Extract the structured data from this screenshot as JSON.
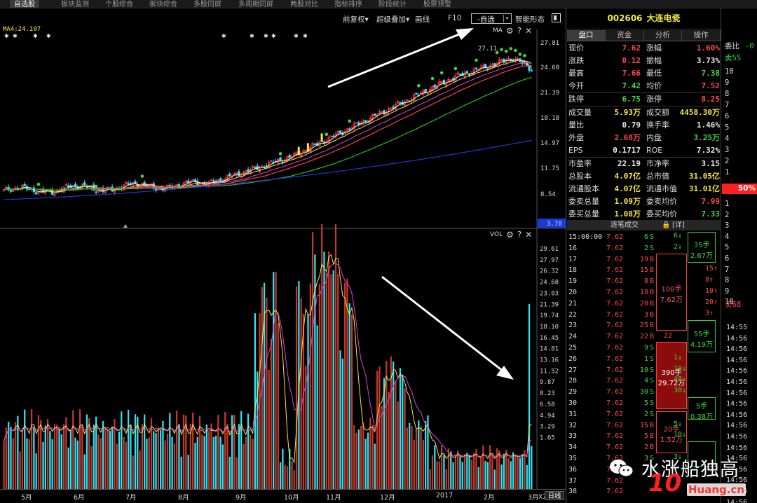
{
  "top_tabs": [
    "自选股",
    "板块监测",
    "个股综合",
    "板块综合",
    "多股同屏",
    "多周期同屏",
    "两股对比",
    "指标排序",
    "阶段统计",
    "股票预警"
  ],
  "toolbar": {
    "restore": "前复权▾",
    "overlay": "超级叠加▾",
    "draw": "画线",
    "f10": "F10",
    "watchlist": "-自选",
    "watch_dropdown": "▾",
    "smart": "智能形态"
  },
  "ma_panel": {
    "label": "MA",
    "ma_value": "MA4:24.107"
  },
  "vol_panel": {
    "label": "VOL"
  },
  "price_axis": [
    "27.81",
    "24.60",
    "21.39",
    "18.18",
    "14.97",
    "11.75",
    "8.54",
    "3.78"
  ],
  "vol_axis": [
    "29.61",
    "27.97",
    "26.32",
    "24.68",
    "23.03",
    "21.39",
    "19.74",
    "18.10",
    "16.45",
    "14.81",
    "13.16",
    "11.52",
    "9.87",
    "8.23",
    "6.58",
    "4.94",
    "3.29",
    "1.65"
  ],
  "high_label": "27.11",
  "months": [
    "5月",
    "6月",
    "7月",
    "8月",
    "9月",
    "10月",
    "11月",
    "12月",
    "2017",
    "2月",
    "3月"
  ],
  "vol_unit": "X万",
  "period_button": "日线",
  "stock": {
    "code": "002606",
    "name": "大连电瓷"
  },
  "quote_tabs": [
    "盘口",
    "资金",
    "分析",
    "操作"
  ],
  "quote_rows": [
    {
      "k1": "现价",
      "v1": "7.62",
      "c1": "red",
      "k2": "涨幅",
      "v2": "1.60%",
      "c2": "red"
    },
    {
      "k1": "涨跌",
      "v1": "0.12",
      "c1": "red",
      "k2": "振幅",
      "v2": "3.73%",
      "c2": "white"
    },
    {
      "k1": "最高",
      "v1": "7.66",
      "c1": "red",
      "k2": "最低",
      "v2": "7.38",
      "c2": "green"
    },
    {
      "k1": "今开",
      "v1": "7.42",
      "c1": "green",
      "k2": "均价",
      "v2": "7.52",
      "c2": "red"
    },
    {
      "k1": "跌停",
      "v1": "6.75",
      "c1": "green",
      "k2": "涨停",
      "v2": "8.25",
      "c2": "red"
    },
    {
      "k1": "成交量",
      "v1": "5.93万",
      "c1": "yellow",
      "k2": "成交额",
      "v2": "4458.30万",
      "c2": "yellow"
    },
    {
      "k1": "量比",
      "v1": "0.79",
      "c1": "white",
      "k2": "换手率",
      "v2": "1.46%",
      "c2": "white"
    },
    {
      "k1": "外盘",
      "v1": "2.68万",
      "c1": "red",
      "k2": "内盘",
      "v2": "3.25万",
      "c2": "green"
    },
    {
      "k1": "EPS",
      "v1": "0.1717",
      "c1": "white",
      "k2": "ROE",
      "v2": "7.32%",
      "c2": "white"
    },
    {
      "k1": "市盈率",
      "v1": "22.19",
      "c1": "white",
      "k2": "市净率",
      "v2": "3.15",
      "c2": "white"
    },
    {
      "k1": "总股本",
      "v1": "4.07亿",
      "c1": "yellow",
      "k2": "总市值",
      "v2": "31.05亿",
      "c2": "yellow"
    },
    {
      "k1": "流通股本",
      "v1": "4.07亿",
      "c1": "yellow",
      "k2": "流通市值",
      "v2": "31.01亿",
      "c2": "yellow"
    },
    {
      "k1": "委卖总量",
      "v1": "1.09万",
      "c1": "yellow",
      "k2": "委卖均价",
      "v2": "7.99",
      "c2": "red"
    },
    {
      "k1": "委买总量",
      "v1": "1.08万",
      "c1": "yellow",
      "k2": "委买均价",
      "v2": "7.33",
      "c2": "green"
    }
  ],
  "ticks_header": {
    "title": "逐笔成交",
    "detail": "[详]"
  },
  "ticks": [
    {
      "t": "15:00:00",
      "p": "7.62",
      "v": "6",
      "s": "S"
    },
    {
      "t": "16",
      "p": "7.62",
      "v": "2",
      "s": "S"
    },
    {
      "t": "17",
      "p": "7.62",
      "v": "19",
      "s": "B"
    },
    {
      "t": "18",
      "p": "7.62",
      "v": "15",
      "s": "B"
    },
    {
      "t": "19",
      "p": "7.62",
      "v": "8",
      "s": "B"
    },
    {
      "t": "20",
      "p": "7.62",
      "v": "18",
      "s": "B"
    },
    {
      "t": "21",
      "p": "7.62",
      "v": "20",
      "s": "B"
    },
    {
      "t": "22",
      "p": "7.62",
      "v": "3",
      "s": "B"
    },
    {
      "t": "23",
      "p": "7.62",
      "v": "25",
      "s": "B"
    },
    {
      "t": "24",
      "p": "7.62",
      "v": "22",
      "s": "B"
    },
    {
      "t": "25",
      "p": "7.62",
      "v": "9",
      "s": "S"
    },
    {
      "t": "26",
      "p": "7.62",
      "v": "1",
      "s": "S"
    },
    {
      "t": "27",
      "p": "7.62",
      "v": "10",
      "s": "S"
    },
    {
      "t": "28",
      "p": "7.62",
      "v": "4",
      "s": "S"
    },
    {
      "t": "29",
      "p": "7.62",
      "v": "30",
      "s": "S"
    },
    {
      "t": "30",
      "p": "7.62",
      "v": "5",
      "s": "S"
    },
    {
      "t": "31",
      "p": "7.62",
      "v": "2",
      "s": "S"
    },
    {
      "t": "32",
      "p": "7.62",
      "v": "15",
      "s": "B"
    },
    {
      "t": "33",
      "p": "7.62",
      "v": "5",
      "s": "B"
    },
    {
      "t": "34",
      "p": "7.62",
      "v": "2",
      "s": "B"
    },
    {
      "t": "35",
      "p": "7.62",
      "v": "3",
      "s": "S"
    },
    {
      "t": "36",
      "p": "7.62",
      "v": "",
      "s": "S"
    },
    {
      "t": "37",
      "p": "7.62",
      "v": "",
      "s": ""
    },
    {
      "t": "38",
      "p": "7.62",
      "v": "",
      "s": ""
    }
  ],
  "sell_boxes": [
    {
      "top": "100手",
      "bottom": "7.62万"
    },
    {
      "top": "390手",
      "bottom": "29.72万"
    },
    {
      "top": "20手",
      "bottom": "1.52万"
    }
  ],
  "box_side_values": [
    "22"
  ],
  "buy_side": [
    {
      "v": "6",
      "a": "↓"
    },
    {
      "v": "2",
      "a": "↓"
    },
    {
      "v": "",
      "a": ""
    },
    {
      "v": "15",
      "a": "↑"
    },
    {
      "v": "8",
      "a": "↑"
    },
    {
      "v": "10",
      "a": "↑"
    },
    {
      "v": "20",
      "a": "↑"
    },
    {
      "v": "3",
      "a": "↑"
    },
    {
      "v": "",
      "a": ""
    },
    {
      "v": "",
      "a": ""
    },
    {
      "v": "",
      "a": ""
    },
    {
      "v": "1",
      "a": "↓"
    },
    {
      "v": "10",
      "a": "↓"
    },
    {
      "v": "40",
      "a": "↓"
    },
    {
      "v": "30",
      "a": "↓"
    },
    {
      "v": "",
      "a": ""
    },
    {
      "v": "",
      "a": ""
    },
    {
      "v": "5",
      "a": "↓"
    },
    {
      "v": "10",
      "a": "↓"
    },
    {
      "v": "",
      "a": ""
    },
    {
      "v": "3",
      "a": "↓"
    }
  ],
  "buy_boxes": [
    {
      "top": "35手",
      "bottom": "2.67万"
    },
    {
      "top": "55手",
      "bottom": "4.19万"
    },
    {
      "top": "5手",
      "bottom": "0.38万"
    }
  ],
  "order_panel": {
    "weibi": "委比",
    "weibi_value": "-0",
    "sell_label": "卖55",
    "sell_levels": [
      "10",
      "9",
      "8",
      "7",
      "6",
      "5",
      "4",
      "3",
      "2",
      "1"
    ],
    "mid": "50%",
    "buy_levels": [
      "1",
      "2",
      "3",
      "4",
      "5",
      "6",
      "7",
      "8",
      "9",
      "10"
    ],
    "buy_label": "买68",
    "times": [
      "14:55",
      "14:56",
      "14:56",
      "14:56",
      "14:56",
      "14:56",
      "14:56",
      "14:56",
      "14:56",
      "14:56",
      "14:56",
      "14:56",
      "14:56",
      "14:56",
      "14:56",
      "14:56",
      "14:56"
    ]
  },
  "watermark": {
    "text": "水涨船独高",
    "logo": "10",
    "url": "Huang.cn"
  },
  "colors": {
    "up": "#ff4a4a",
    "down": "#3ddb3d",
    "cyan_bar": "#33e0f0",
    "red_bar": "#c0392b",
    "ma_yellow": "#f4e842",
    "ma_magenta": "#e040e0",
    "ma_green": "#22c022",
    "ma_blue": "#2238d8",
    "highlight": "#ff2020"
  }
}
